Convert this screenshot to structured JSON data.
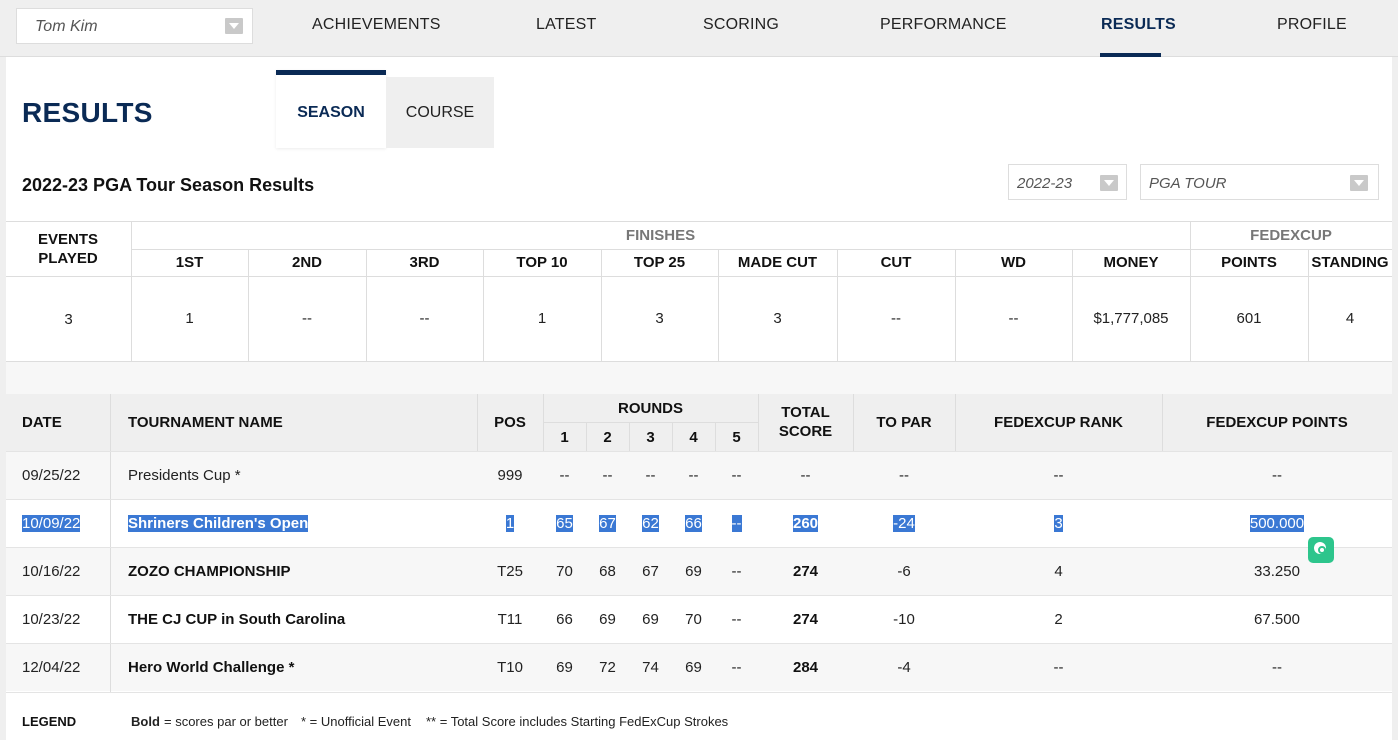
{
  "player_select": {
    "value": "Tom Kim"
  },
  "nav": [
    {
      "label": "ACHIEVEMENTS"
    },
    {
      "label": "LATEST"
    },
    {
      "label": "SCORING"
    },
    {
      "label": "PERFORMANCE"
    },
    {
      "label": "RESULTS",
      "active": true
    },
    {
      "label": "PROFILE"
    }
  ],
  "page_title": "RESULTS",
  "tabs": {
    "season": "SEASON",
    "course": "COURSE",
    "active": "season"
  },
  "season_heading": "2022-23 PGA Tour Season Results",
  "season_select": {
    "value": "2022-23"
  },
  "tour_select": {
    "value": "PGA TOUR"
  },
  "summary": {
    "group_finishes": "FINISHES",
    "group_fedexcup": "FEDEXCUP",
    "headers": {
      "events_played": "EVENTS PLAYED",
      "first": "1ST",
      "second": "2ND",
      "third": "3RD",
      "top10": "TOP 10",
      "top25": "TOP 25",
      "made_cut": "MADE CUT",
      "cut": "CUT",
      "wd": "WD",
      "money": "MONEY",
      "points": "POINTS",
      "standing": "STANDING"
    },
    "values": {
      "events_played": "3",
      "first": "1",
      "second": "--",
      "third": "--",
      "top10": "1",
      "top25": "3",
      "made_cut": "3",
      "cut": "--",
      "wd": "--",
      "money": "$1,777,085",
      "points": "601",
      "standing": "4"
    }
  },
  "results_table": {
    "headers": {
      "date": "DATE",
      "tournament": "TOURNAMENT NAME",
      "pos": "POS",
      "rounds": "ROUNDS",
      "r1": "1",
      "r2": "2",
      "r3": "3",
      "r4": "4",
      "r5": "5",
      "total_line1": "TOTAL",
      "total_line2": "SCORE",
      "to_par": "TO PAR",
      "fedex_rank": "FEDEXCUP RANK",
      "fedex_points": "FEDEXCUP POINTS"
    },
    "rows": [
      {
        "date": "09/25/22",
        "name": "Presidents Cup *",
        "pos": "999",
        "r1": "--",
        "r2": "--",
        "r3": "--",
        "r4": "--",
        "r5": "--",
        "total": "--",
        "to_par": "--",
        "rank": "--",
        "points": "--"
      },
      {
        "date": "10/09/22",
        "name": "Shriners Children's Open",
        "pos": "1",
        "r1": "65",
        "r2": "67",
        "r3": "62",
        "r4": "66",
        "r5": "--",
        "total": "260",
        "to_par": "-24",
        "rank": "3",
        "points": "500.000"
      },
      {
        "date": "10/16/22",
        "name": "ZOZO CHAMPIONSHIP",
        "pos": "T25",
        "r1": "70",
        "r2": "68",
        "r3": "67",
        "r4": "69",
        "r5": "--",
        "total": "274",
        "to_par": "-6",
        "rank": "4",
        "points": "33.250"
      },
      {
        "date": "10/23/22",
        "name": "THE CJ CUP in South Carolina",
        "pos": "T11",
        "r1": "66",
        "r2": "69",
        "r3": "69",
        "r4": "70",
        "r5": "--",
        "total": "274",
        "to_par": "-10",
        "rank": "2",
        "points": "67.500"
      },
      {
        "date": "12/04/22",
        "name": "Hero World Challenge *",
        "pos": "T10",
        "r1": "69",
        "r2": "72",
        "r3": "74",
        "r4": "69",
        "r5": "--",
        "total": "284",
        "to_par": "-4",
        "rank": "--",
        "points": "--"
      }
    ]
  },
  "legend": {
    "title": "LEGEND",
    "bold_word": "Bold",
    "bold_desc": "= scores par or better",
    "unofficial": "* = Unofficial Event",
    "total_note": "** = Total Score includes Starting FedExCup Strokes"
  },
  "colors": {
    "navy": "#0a2a55",
    "selection": "#3a78d4",
    "feedback": "#2dc58c"
  },
  "icons": [
    "chevron-down-icon",
    "feedback-search-icon"
  ]
}
